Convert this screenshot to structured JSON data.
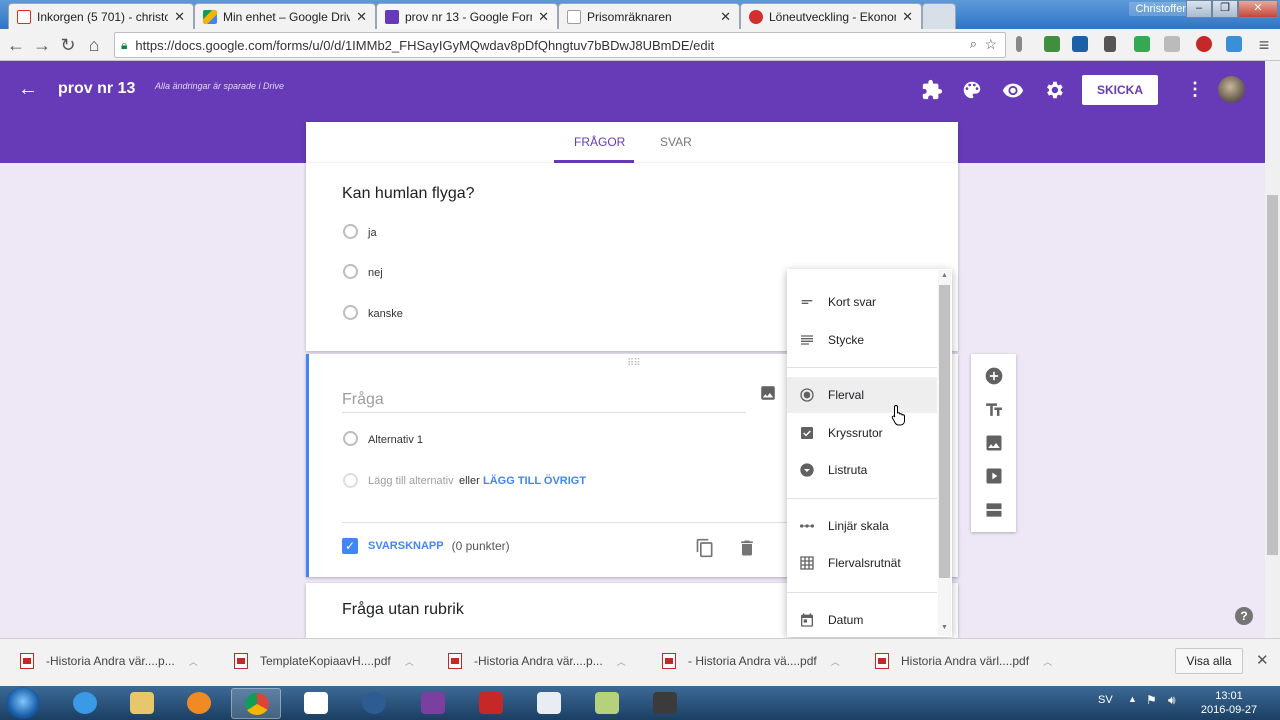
{
  "browser": {
    "tabs": [
      {
        "title": "Inkorgen (5 701) - christo",
        "color": "#d93025"
      },
      {
        "title": "Min enhet – Google Driv",
        "color": "#1e88e5"
      },
      {
        "title": "prov nr 13 - Google Form",
        "color": "#673ab7"
      },
      {
        "title": "Prisomräknaren",
        "color": "#9e9e9e"
      },
      {
        "title": "Löneutveckling - Ekonom",
        "color": "#d32f2f"
      }
    ],
    "user_label": "Christoffer",
    "url": "https://docs.google.com/forms/u/0/d/1IMMb2_FHSayIGyMQwdav8pDfQhngtuv7bBDwJ8UBmDE/edit"
  },
  "form": {
    "title": "prov nr 13",
    "save_status": "Alla ändringar är sparade i Drive",
    "send_label": "SKICKA",
    "tabs": {
      "questions": "FRÅGOR",
      "responses": "SVAR"
    },
    "accent": "#673ab7"
  },
  "question1": {
    "title": "Kan humlan flyga?",
    "options": [
      "ja",
      "nej",
      "kanske"
    ]
  },
  "question2": {
    "placeholder": "Fråga",
    "option1": "Alternativ 1",
    "add_option": "Lägg till alternativ",
    "or": "eller",
    "add_other": "LÄGG TILL ÖVRIGT",
    "answer_key": "SVARSKNAPP",
    "points": "(0 punkter)"
  },
  "question3": {
    "title": "Fråga utan rubrik"
  },
  "type_menu": {
    "items": [
      {
        "label": "Kort svar",
        "icon": "short-answer-icon"
      },
      {
        "label": "Stycke",
        "icon": "paragraph-icon"
      },
      {
        "label": "Flerval",
        "icon": "radio-icon",
        "highlighted": true
      },
      {
        "label": "Kryssrutor",
        "icon": "checkbox-icon"
      },
      {
        "label": "Listruta",
        "icon": "dropdown-icon"
      },
      {
        "label": "Linjär skala",
        "icon": "linear-scale-icon"
      },
      {
        "label": "Flervalsrutnät",
        "icon": "grid-icon"
      },
      {
        "label": "Datum",
        "icon": "calendar-icon"
      }
    ]
  },
  "downloads": {
    "items": [
      "-Historia Andra vär....p...",
      "TemplateKopiaavH....pdf",
      "-Historia Andra vär....p...",
      "- Historia Andra vä....pdf",
      "Historia Andra värl....pdf"
    ],
    "show_all": "Visa alla"
  },
  "taskbar": {
    "language": "SV",
    "time": "13:01",
    "date": "2016-09-27"
  }
}
